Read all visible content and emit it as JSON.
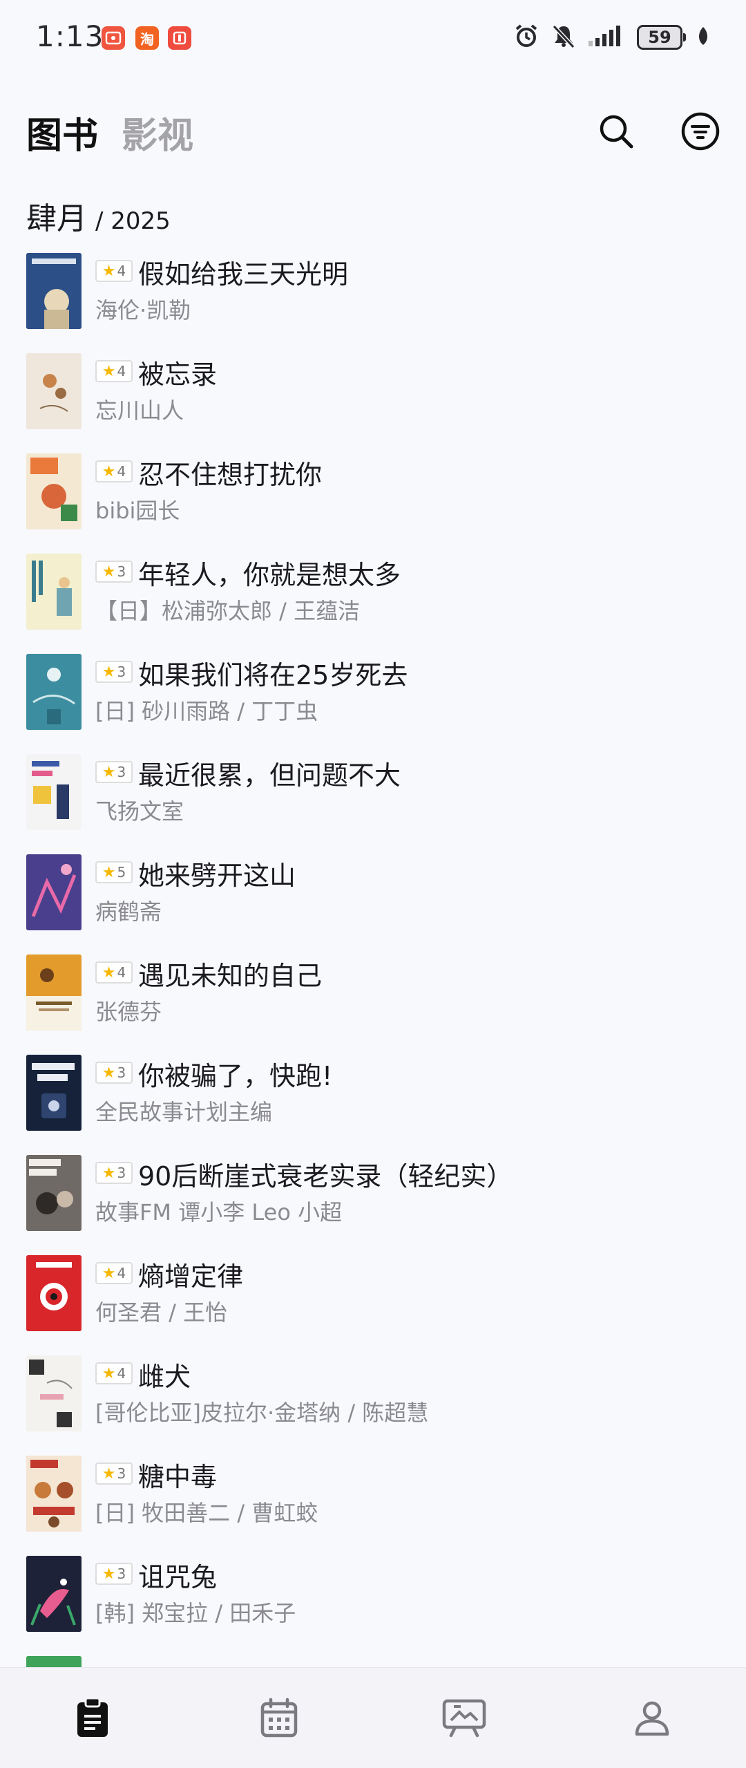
{
  "status_bar": {
    "time": "1:13",
    "notifications": [
      {
        "name": "app-notification-icon",
        "glyph": "🀫"
      },
      {
        "name": "taobao-icon",
        "glyph": "淘"
      },
      {
        "name": "app-notification-icon",
        "glyph": "▯"
      }
    ],
    "battery": "59"
  },
  "header": {
    "tab_books": "图书",
    "tab_films": "影视",
    "active_tab": "图书"
  },
  "month": {
    "name": "肆月",
    "year": "/ 2025"
  },
  "books": [
    {
      "rating": "4",
      "title": "假如给我三天光明",
      "author": "海伦·凯勒",
      "cover_color": "#2b4f86"
    },
    {
      "rating": "4",
      "title": "被忘录",
      "author": "忘川山人",
      "cover_color": "#efe7dc"
    },
    {
      "rating": "4",
      "title": "忍不住想打扰你",
      "author": "bibi园长",
      "cover_color": "#f4e8d2"
    },
    {
      "rating": "3",
      "title": "年轻人，你就是想太多",
      "author": "【日】松浦弥太郎 / 王蕴洁",
      "cover_color": "#f3efcf"
    },
    {
      "rating": "3",
      "title": "如果我们将在25岁死去",
      "author": "[日] 砂川雨路 / 丁丁虫",
      "cover_color": "#3d8da0"
    },
    {
      "rating": "3",
      "title": "最近很累，但问题不大",
      "author": "飞扬文室",
      "cover_color": "#f4f4f4"
    },
    {
      "rating": "5",
      "title": "她来劈开这山",
      "author": "病鹤斋",
      "cover_color": "#4a3f8c"
    },
    {
      "rating": "4",
      "title": "遇见未知的自己",
      "author": "张德芬",
      "cover_color": "#e39b2b"
    },
    {
      "rating": "3",
      "title": "你被骗了，快跑!",
      "author": "全民故事计划主编",
      "cover_color": "#15223a"
    },
    {
      "rating": "3",
      "title": "90后断崖式衰老实录（轻纪实）",
      "author": "故事FM 谭小李 Leo 小超",
      "cover_color": "#6f6a66"
    },
    {
      "rating": "4",
      "title": "熵增定律",
      "author": "何圣君 / 王怡",
      "cover_color": "#d8262b"
    },
    {
      "rating": "4",
      "title": "雌犬",
      "author": "[哥伦比亚]皮拉尔·金塔纳 / 陈超慧",
      "cover_color": "#f4f2ee"
    },
    {
      "rating": "3",
      "title": "糖中毒",
      "author": "[日] 牧田善二 / 曹虹蛟",
      "cover_color": "#c33b2e"
    },
    {
      "rating": "3",
      "title": "诅咒兔",
      "author": "[韩] 郑宝拉 / 田禾子",
      "cover_color": "#1e2238"
    },
    {
      "rating": "",
      "title": "",
      "author": "",
      "cover_color": "#3fa35a"
    }
  ],
  "bottom_nav": [
    {
      "name": "nav-books-icon"
    },
    {
      "name": "nav-calendar-icon"
    },
    {
      "name": "nav-films-icon"
    },
    {
      "name": "nav-profile-icon"
    }
  ]
}
